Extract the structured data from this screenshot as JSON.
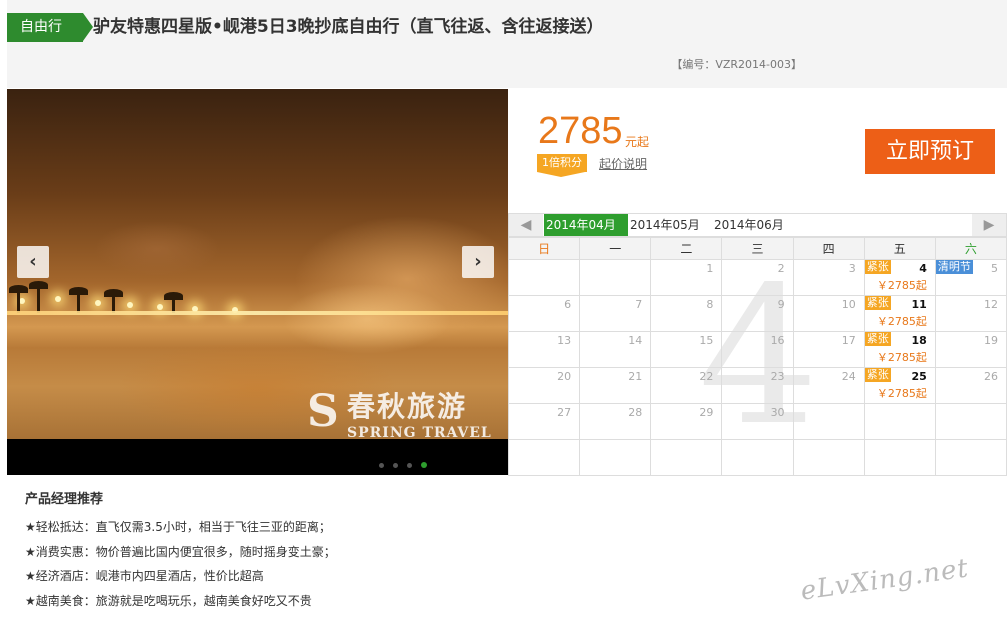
{
  "header": {
    "tag": "自由行",
    "title": "驴友特惠四星版•岘港5日3晚抄底自由行（直飞往返、含往返接送）",
    "code": "【编号：VZR2014-003】"
  },
  "hero": {
    "watermark_cn": "春秋旅游",
    "watermark_en": "SPRING TRAVEL",
    "watermark_mark": "S",
    "slide_count": 4,
    "active_slide": 4,
    "prev_icon": "‹",
    "next_icon": "›"
  },
  "price": {
    "amount": "2785",
    "unit": "元起",
    "points": "1倍积分",
    "note": "起价说明",
    "book": "立即预订"
  },
  "calendar": {
    "prev": "◀",
    "next": "▶",
    "months": [
      "2014年04月",
      "2014年05月",
      "2014年06月"
    ],
    "active_month": 0,
    "big_month": "4",
    "weekdays": [
      "日",
      "一",
      "二",
      "三",
      "四",
      "五",
      "六"
    ],
    "tight_label": "紧张",
    "price_label": "￥2785起",
    "holiday_label": "清明节",
    "weeks": [
      [
        null,
        null,
        1,
        2,
        3,
        4,
        5
      ],
      [
        6,
        7,
        8,
        9,
        10,
        11,
        12
      ],
      [
        13,
        14,
        15,
        16,
        17,
        18,
        19
      ],
      [
        20,
        21,
        22,
        23,
        24,
        25,
        26
      ],
      [
        27,
        28,
        29,
        30,
        null,
        null,
        null
      ],
      [
        null,
        null,
        null,
        null,
        null,
        null,
        null
      ]
    ],
    "available_days": [
      4,
      11,
      18,
      25
    ],
    "holiday_day": 5
  },
  "recommend": {
    "title": "产品经理推荐",
    "items": [
      "★轻松抵达：直飞仅需3.5小时，相当于飞往三亚的距离；",
      "★消费实惠：物价普遍比国内便宜很多，随时摇身变土豪；",
      "★经济酒店：岘港市内四星酒店，性价比超高",
      "★越南美食：旅游就是吃喝玩乐，越南美食好吃又不贵"
    ]
  },
  "site_watermark": "eLvXing.net"
}
